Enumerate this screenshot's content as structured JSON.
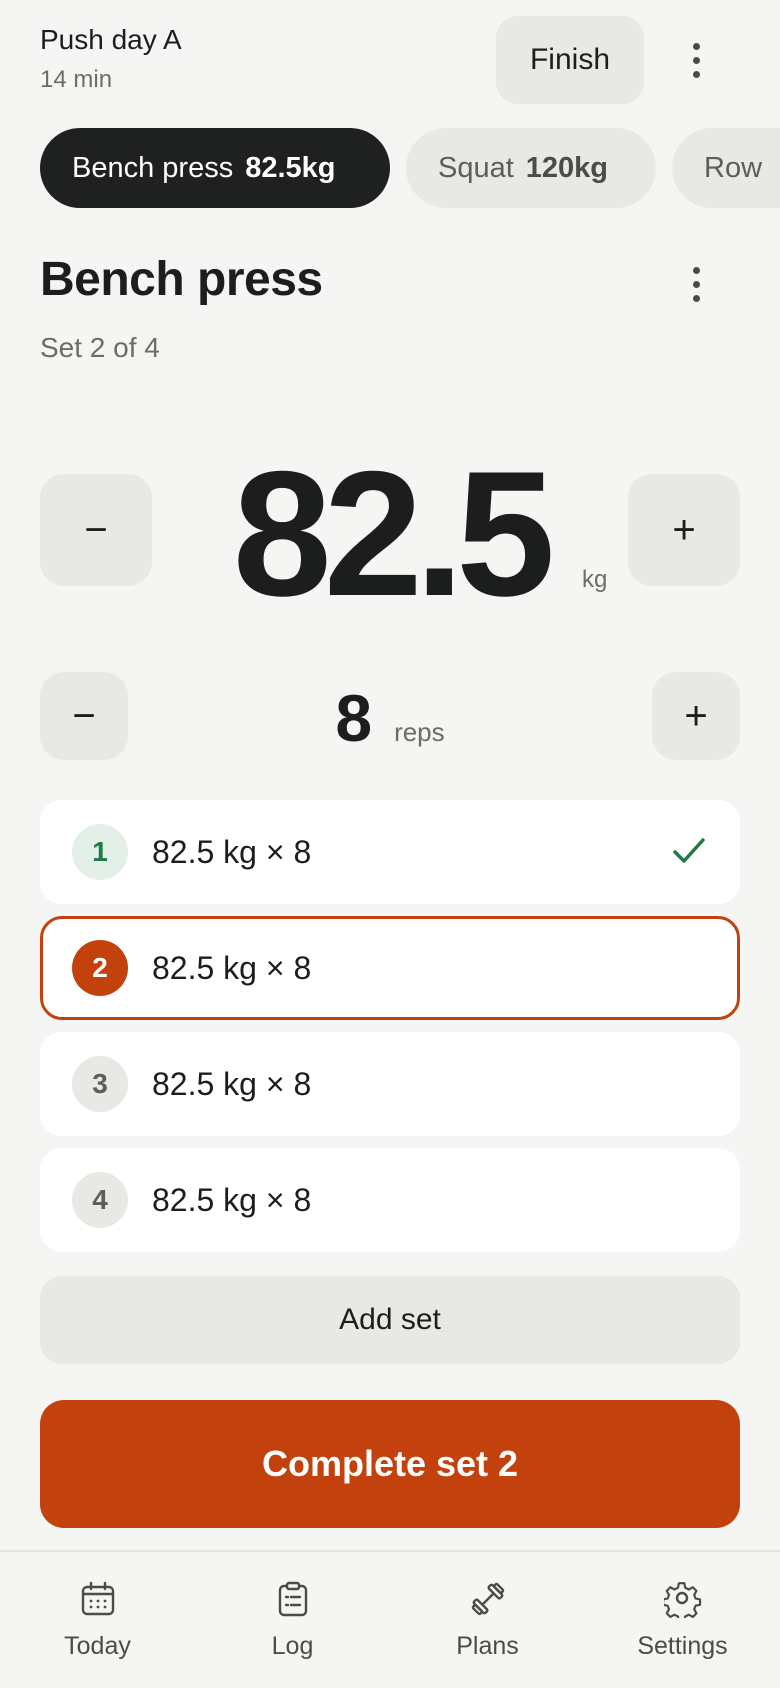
{
  "header": {
    "workout_title": "Push day A",
    "duration": "14 min",
    "finish_label": "Finish"
  },
  "exercise_chips": [
    {
      "name": "Bench press",
      "weight": "82.5kg",
      "active": true
    },
    {
      "name": "Squat",
      "weight": "120kg",
      "active": false
    },
    {
      "name": "Row",
      "weight": "",
      "active": false
    }
  ],
  "exercise": {
    "title": "Bench press",
    "set_progress": "Set 2 of 4"
  },
  "weight_stepper": {
    "value": "82.5",
    "unit": "kg",
    "decrement_glyph": "−",
    "increment_glyph": "+"
  },
  "reps_stepper": {
    "value": "8",
    "unit": "reps",
    "decrement_glyph": "−",
    "increment_glyph": "+"
  },
  "sets": [
    {
      "number": "1",
      "text": "82.5 kg × 8",
      "status": "done"
    },
    {
      "number": "2",
      "text": "82.5 kg × 8",
      "status": "current"
    },
    {
      "number": "3",
      "text": "82.5 kg × 8",
      "status": "pending"
    },
    {
      "number": "4",
      "text": "82.5 kg × 8",
      "status": "pending"
    }
  ],
  "add_set_label": "Add set",
  "complete_label": "Complete set 2",
  "nav": [
    {
      "label": "Today",
      "icon": "calendar-icon"
    },
    {
      "label": "Log",
      "icon": "clipboard-icon"
    },
    {
      "label": "Plans",
      "icon": "dumbbell-icon"
    },
    {
      "label": "Settings",
      "icon": "gear-icon"
    }
  ],
  "colors": {
    "accent": "#c2410c",
    "done_green": "#1f7a45",
    "chip_active": "#1f2020",
    "background": "#f5f5f3"
  }
}
